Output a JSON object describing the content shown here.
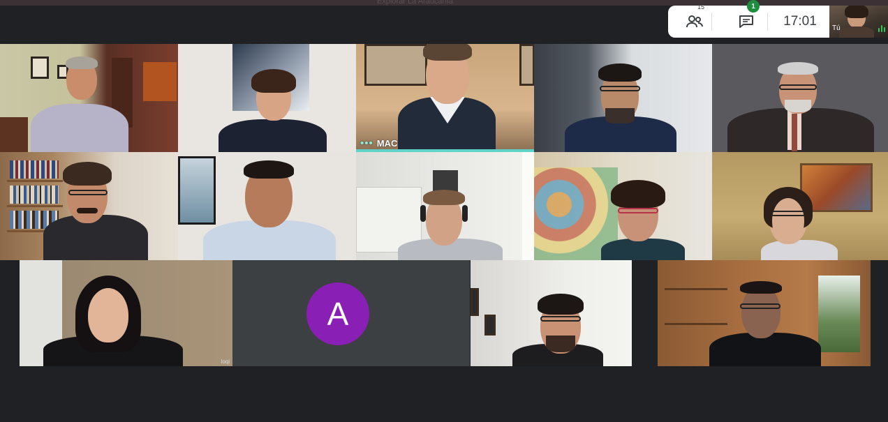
{
  "meeting": {
    "top_title": "Explorar La Araucanía",
    "time": "17:01",
    "participants_count": "15",
    "chat_unread": "1",
    "self_label": "Tú",
    "people_icon": "people-icon",
    "chat_icon": "chat-icon"
  },
  "tiles": [
    {
      "id": "t1",
      "name": ""
    },
    {
      "id": "t2",
      "name": ""
    },
    {
      "id": "t3",
      "name": "MAC",
      "speaking": true
    },
    {
      "id": "t4",
      "name": ""
    },
    {
      "id": "t5",
      "name": ""
    },
    {
      "id": "t6",
      "name": ""
    },
    {
      "id": "t7",
      "name": ""
    },
    {
      "id": "t8",
      "name": ""
    },
    {
      "id": "t9",
      "name": ""
    },
    {
      "id": "t10",
      "name": ""
    },
    {
      "id": "t11",
      "name": "",
      "caption": "loqi"
    },
    {
      "id": "t12",
      "name": "",
      "avatar_letter": "A"
    },
    {
      "id": "t13",
      "name": ""
    },
    {
      "id": "t14",
      "name": ""
    }
  ],
  "colors": {
    "background": "#202124",
    "speaking_accent": "#5fd3c8",
    "avatar_purple": "#8a1fb5",
    "badge_green": "#1e8e3e"
  }
}
